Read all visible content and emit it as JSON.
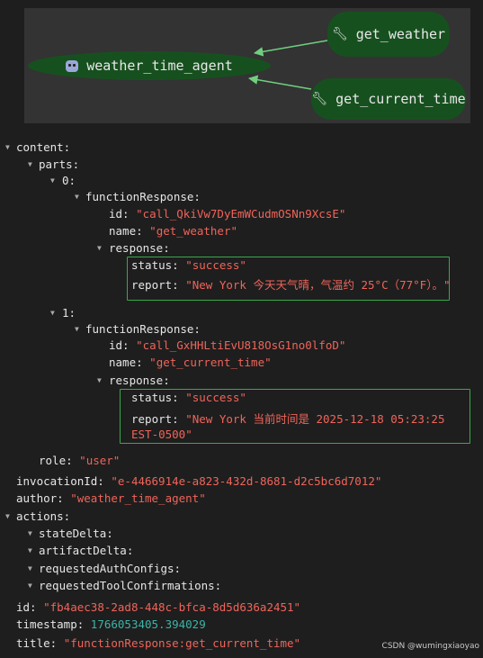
{
  "graph": {
    "agent_label": "weather_time_agent",
    "tool1_label": "get_weather",
    "tool2_label": "get_current_time",
    "agent_icon": "robot-icon",
    "tool_icon": "wrench-icon"
  },
  "tree": {
    "content": "content:",
    "parts": "parts:",
    "idx0": "0:",
    "idx1": "1:",
    "functionResponse": "functionResponse:",
    "id_key": "id:",
    "name_key": "name:",
    "response_key": "response:",
    "status_key": "status:",
    "report_key": "report:",
    "p0_id": "\"call_QkiVw7DyEmWCudmOSNn9XcsE\"",
    "p0_name": "\"get_weather\"",
    "p0_status": "\"success\"",
    "p0_report": "\"New York 今天天气晴，气温约 25°C（77°F）。\"",
    "p1_id": "\"call_GxHHLtiEvU818OsG1no0lfoD\"",
    "p1_name": "\"get_current_time\"",
    "p1_status": "\"success\"",
    "p1_report": "\"New York 当前时间是 2025-12-18 05:23:25 EST-0500\"",
    "role_key": "role:",
    "role_val": "\"user\"",
    "invocation_key": "invocationId:",
    "invocation_val": "\"e-4466914e-a823-432d-8681-d2c5bc6d7012\"",
    "author_key": "author:",
    "author_val": "\"weather_time_agent\"",
    "actions_key": "actions:",
    "stateDelta": "stateDelta:",
    "artifactDelta": "artifactDelta:",
    "requestedAuthConfigs": "requestedAuthConfigs:",
    "requestedToolConfirmations": "requestedToolConfirmations:",
    "event_id_key": "id:",
    "event_id_val": "\"fb4aec38-2ad8-448c-bfca-8d5d636a2451\"",
    "timestamp_key": "timestamp:",
    "timestamp_val": "1766053405.394029",
    "title_key": "title:",
    "title_val": "\"functionResponse:get_current_time\""
  },
  "watermark": "CSDN @wumingxiaoyao",
  "colors": {
    "background": "#1e1e1e",
    "graph_bg": "#333333",
    "node_fill": "#17501f",
    "edge": "#6fcf7f",
    "string": "#f0645a",
    "number": "#3cb4a6",
    "highlight_box": "#3aa84a"
  }
}
